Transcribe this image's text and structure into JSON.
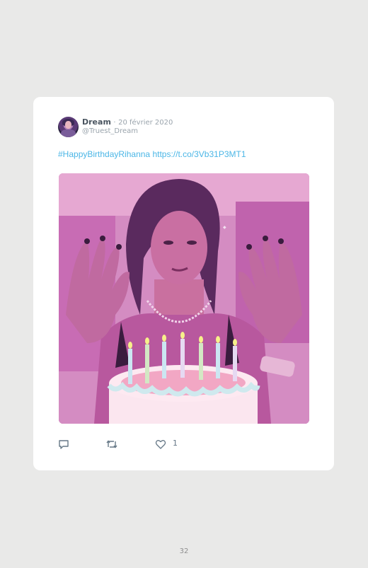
{
  "tweet": {
    "author_name": "Dream",
    "separator": "·",
    "date": "20 février 2020",
    "handle": "@Truest_Dream",
    "hashtag": "#HappyBirthdayRihanna",
    "link": "https://t.co/3Vb31P3MT1",
    "like_count": "1",
    "media_description_icon": "birthday-cake-image"
  },
  "page": {
    "number": "32"
  },
  "colors": {
    "background": "#e9e9e8",
    "card": "#ffffff",
    "link": "#4bb6e6",
    "icon": "#657786"
  }
}
